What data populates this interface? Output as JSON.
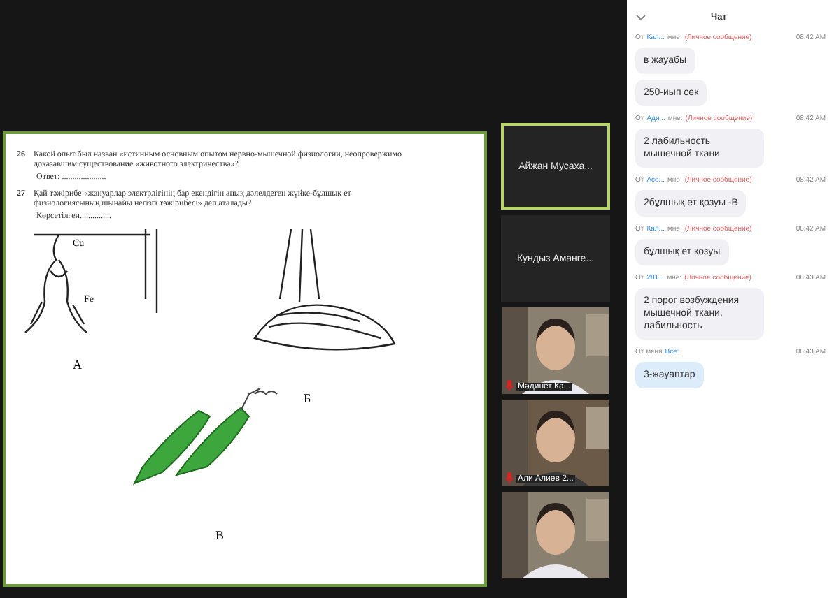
{
  "shared_document": {
    "questions": [
      {
        "number": "26",
        "text": "Какой опыт был назван «истинным основным опытом нервно-мышечной физиологии, неопровержимо доказавшим существование «животного электричества»?",
        "answer": "Ответ: ....................."
      },
      {
        "number": "27",
        "text": "Қай тәжірибе «жануарлар электрлігінің бар екендігін анық дәлелдеген жүйке-бұлшық ет физиологиясының шынайы негізгі тәжірибесі» деп аталады?",
        "answer": "Көрсетілген..............."
      }
    ],
    "figures": [
      {
        "label": "А",
        "kind": "hook",
        "annotations": [
          "Cu",
          "Fe"
        ]
      },
      {
        "label": "Б",
        "kind": "muscle"
      },
      {
        "label": "В",
        "kind": "legs"
      }
    ]
  },
  "participants": [
    {
      "kind": "name",
      "name": "Айжан  Мусаха...",
      "active": true
    },
    {
      "kind": "name",
      "name": "Кундыз  Аманге...",
      "active": false
    },
    {
      "kind": "video",
      "name": "Мәдинет Ка...",
      "muted": true
    },
    {
      "kind": "video",
      "name": "Али Алиев 2...",
      "muted": true
    },
    {
      "kind": "video"
    }
  ],
  "chat": {
    "title": "Чат",
    "messages": [
      {
        "from": "От",
        "sender": "Кал...",
        "recipient": "мне:",
        "note": "(Личное сообщение)",
        "time": "08:42 AM",
        "own": false,
        "texts": [
          "в жауабы",
          "250-иып сек"
        ]
      },
      {
        "from": "От",
        "sender": "Ади...",
        "recipient": "мне:",
        "note": "(Личное сообщение)",
        "time": "08:42 AM",
        "own": false,
        "texts": [
          "2 лабильность мышечной ткани"
        ]
      },
      {
        "from": "От",
        "sender": "Асе...",
        "recipient": "мне:",
        "note": "(Личное сообщение)",
        "time": "08:42 AM",
        "own": false,
        "texts": [
          "2бұлшық ет қозуы -В"
        ]
      },
      {
        "from": "От",
        "sender": "Кал...",
        "recipient": "мне:",
        "note": "(Личное сообщение)",
        "time": "08:42 AM",
        "own": false,
        "texts": [
          "бұлшық ет қозуы"
        ]
      },
      {
        "from": "От",
        "sender": "281...",
        "recipient": "мне:",
        "note": "(Личное сообщение)",
        "time": "08:43 AM",
        "own": false,
        "texts": [
          "2 порог возбуждения мышечной ткани, лабильность"
        ]
      },
      {
        "from": "От меня",
        "sender": "Все:",
        "time": "08:43 AM",
        "own": true,
        "texts": [
          "3-жауаптар"
        ]
      }
    ]
  }
}
